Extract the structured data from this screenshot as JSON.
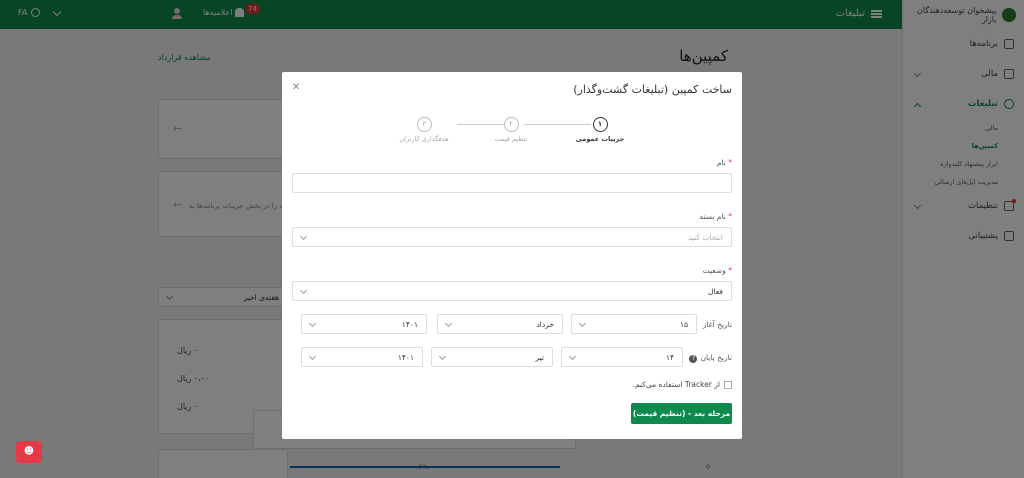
{
  "topbar": {
    "menu_title": "تبلیغات",
    "notifications_label": "اعلامیه‌ها",
    "notifications_count": "74",
    "language": "FA"
  },
  "sidebar": {
    "brand": "پیشخوان توسعه‌دهندگان بازار",
    "items": [
      {
        "label": "برنامه‌ها"
      },
      {
        "label": "مالی"
      },
      {
        "label": "تبلیغات"
      },
      {
        "label": "تنظیمات"
      },
      {
        "label": "پشتیبانی"
      }
    ],
    "ads_sub": [
      "مالی",
      "کمپین‌ها",
      "ابزار پیشنهاد کلیدواژه",
      "مدیریت اپل‌های ارسالی"
    ]
  },
  "page": {
    "title": "کمپین‌ها",
    "contract_link": "مشاهده قرارداد",
    "card_text": "شود را در بخش جزییات برنامه‌ها به",
    "period_select": "هفته‌ی اخیر",
    "amounts": [
      "۰ ریال",
      "۰،۰۰ ریال",
      "۰ ریال"
    ],
    "chart_left_label": "0%",
    "chart_right_label": "0"
  },
  "modal": {
    "title": "ساخت کمپین (تبلیغات گشت‌وگذار)",
    "steps": [
      {
        "num": "۱",
        "label": "جزییات عمومی"
      },
      {
        "num": "۲",
        "label": "تنظیم قیمت"
      },
      {
        "num": "۳",
        "label": "هدفگذاری کاربران"
      }
    ],
    "name_label": "نام",
    "package_label": "نام بسته",
    "package_placeholder": "انتخاب کنید",
    "status_label": "وضعیت",
    "status_value": "فعال",
    "start_label": "تاریخ آغاز",
    "start_day": "۱۵",
    "start_month": "خرداد",
    "start_year": "۱۴۰۱",
    "end_label": "تاریخ پایان",
    "end_day": "۱۴",
    "end_month": "تیر",
    "end_year": "۱۴۰۱",
    "tracker_label": "از Tracker استفاده می‌کنم.",
    "next_button": "مرحله بعد - (تنظیم قیمت)"
  }
}
